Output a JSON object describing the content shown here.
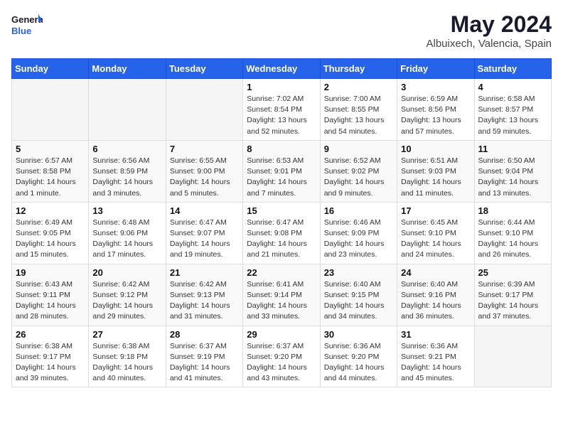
{
  "logo": {
    "line1": "General",
    "line2": "Blue"
  },
  "title": "May 2024",
  "location": "Albuixech, Valencia, Spain",
  "weekdays": [
    "Sunday",
    "Monday",
    "Tuesday",
    "Wednesday",
    "Thursday",
    "Friday",
    "Saturday"
  ],
  "weeks": [
    [
      {
        "day": "",
        "info": ""
      },
      {
        "day": "",
        "info": ""
      },
      {
        "day": "",
        "info": ""
      },
      {
        "day": "1",
        "info": "Sunrise: 7:02 AM\nSunset: 8:54 PM\nDaylight: 13 hours\nand 52 minutes."
      },
      {
        "day": "2",
        "info": "Sunrise: 7:00 AM\nSunset: 8:55 PM\nDaylight: 13 hours\nand 54 minutes."
      },
      {
        "day": "3",
        "info": "Sunrise: 6:59 AM\nSunset: 8:56 PM\nDaylight: 13 hours\nand 57 minutes."
      },
      {
        "day": "4",
        "info": "Sunrise: 6:58 AM\nSunset: 8:57 PM\nDaylight: 13 hours\nand 59 minutes."
      }
    ],
    [
      {
        "day": "5",
        "info": "Sunrise: 6:57 AM\nSunset: 8:58 PM\nDaylight: 14 hours\nand 1 minute."
      },
      {
        "day": "6",
        "info": "Sunrise: 6:56 AM\nSunset: 8:59 PM\nDaylight: 14 hours\nand 3 minutes."
      },
      {
        "day": "7",
        "info": "Sunrise: 6:55 AM\nSunset: 9:00 PM\nDaylight: 14 hours\nand 5 minutes."
      },
      {
        "day": "8",
        "info": "Sunrise: 6:53 AM\nSunset: 9:01 PM\nDaylight: 14 hours\nand 7 minutes."
      },
      {
        "day": "9",
        "info": "Sunrise: 6:52 AM\nSunset: 9:02 PM\nDaylight: 14 hours\nand 9 minutes."
      },
      {
        "day": "10",
        "info": "Sunrise: 6:51 AM\nSunset: 9:03 PM\nDaylight: 14 hours\nand 11 minutes."
      },
      {
        "day": "11",
        "info": "Sunrise: 6:50 AM\nSunset: 9:04 PM\nDaylight: 14 hours\nand 13 minutes."
      }
    ],
    [
      {
        "day": "12",
        "info": "Sunrise: 6:49 AM\nSunset: 9:05 PM\nDaylight: 14 hours\nand 15 minutes."
      },
      {
        "day": "13",
        "info": "Sunrise: 6:48 AM\nSunset: 9:06 PM\nDaylight: 14 hours\nand 17 minutes."
      },
      {
        "day": "14",
        "info": "Sunrise: 6:47 AM\nSunset: 9:07 PM\nDaylight: 14 hours\nand 19 minutes."
      },
      {
        "day": "15",
        "info": "Sunrise: 6:47 AM\nSunset: 9:08 PM\nDaylight: 14 hours\nand 21 minutes."
      },
      {
        "day": "16",
        "info": "Sunrise: 6:46 AM\nSunset: 9:09 PM\nDaylight: 14 hours\nand 23 minutes."
      },
      {
        "day": "17",
        "info": "Sunrise: 6:45 AM\nSunset: 9:10 PM\nDaylight: 14 hours\nand 24 minutes."
      },
      {
        "day": "18",
        "info": "Sunrise: 6:44 AM\nSunset: 9:10 PM\nDaylight: 14 hours\nand 26 minutes."
      }
    ],
    [
      {
        "day": "19",
        "info": "Sunrise: 6:43 AM\nSunset: 9:11 PM\nDaylight: 14 hours\nand 28 minutes."
      },
      {
        "day": "20",
        "info": "Sunrise: 6:42 AM\nSunset: 9:12 PM\nDaylight: 14 hours\nand 29 minutes."
      },
      {
        "day": "21",
        "info": "Sunrise: 6:42 AM\nSunset: 9:13 PM\nDaylight: 14 hours\nand 31 minutes."
      },
      {
        "day": "22",
        "info": "Sunrise: 6:41 AM\nSunset: 9:14 PM\nDaylight: 14 hours\nand 33 minutes."
      },
      {
        "day": "23",
        "info": "Sunrise: 6:40 AM\nSunset: 9:15 PM\nDaylight: 14 hours\nand 34 minutes."
      },
      {
        "day": "24",
        "info": "Sunrise: 6:40 AM\nSunset: 9:16 PM\nDaylight: 14 hours\nand 36 minutes."
      },
      {
        "day": "25",
        "info": "Sunrise: 6:39 AM\nSunset: 9:17 PM\nDaylight: 14 hours\nand 37 minutes."
      }
    ],
    [
      {
        "day": "26",
        "info": "Sunrise: 6:38 AM\nSunset: 9:17 PM\nDaylight: 14 hours\nand 39 minutes."
      },
      {
        "day": "27",
        "info": "Sunrise: 6:38 AM\nSunset: 9:18 PM\nDaylight: 14 hours\nand 40 minutes."
      },
      {
        "day": "28",
        "info": "Sunrise: 6:37 AM\nSunset: 9:19 PM\nDaylight: 14 hours\nand 41 minutes."
      },
      {
        "day": "29",
        "info": "Sunrise: 6:37 AM\nSunset: 9:20 PM\nDaylight: 14 hours\nand 43 minutes."
      },
      {
        "day": "30",
        "info": "Sunrise: 6:36 AM\nSunset: 9:20 PM\nDaylight: 14 hours\nand 44 minutes."
      },
      {
        "day": "31",
        "info": "Sunrise: 6:36 AM\nSunset: 9:21 PM\nDaylight: 14 hours\nand 45 minutes."
      },
      {
        "day": "",
        "info": ""
      }
    ]
  ]
}
